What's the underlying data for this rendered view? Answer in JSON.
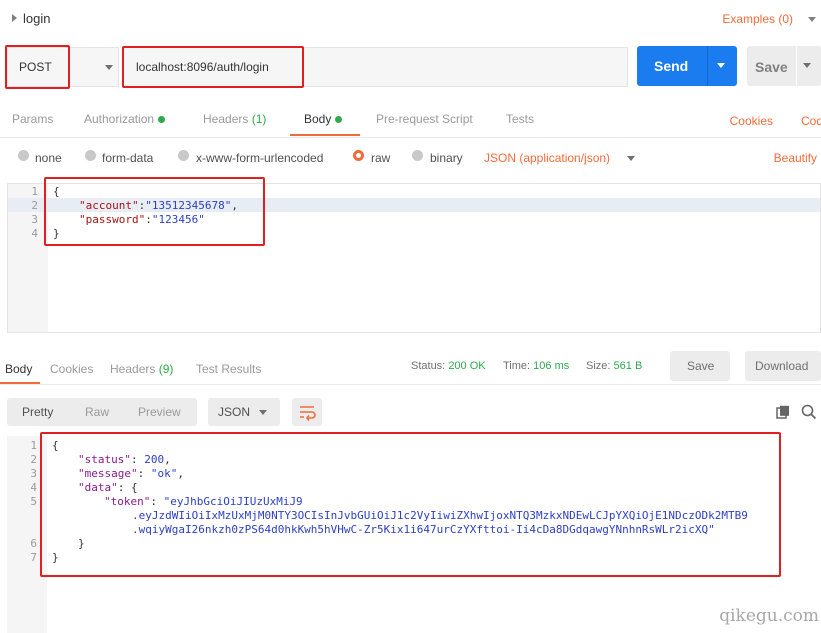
{
  "request": {
    "name": "login",
    "examples_label": "Examples (0)",
    "method": "POST",
    "url": "localhost:8096/auth/login",
    "send_label": "Send",
    "save_label": "Save"
  },
  "request_tabs": {
    "params": "Params",
    "authorization": "Authorization",
    "headers": "Headers",
    "headers_count": "(1)",
    "body": "Body",
    "pre_request": "Pre-request Script",
    "tests": "Tests",
    "cookies": "Cookies",
    "code": "Cod"
  },
  "body_types": {
    "none": "none",
    "form_data": "form-data",
    "urlencoded": "x-www-form-urlencoded",
    "raw": "raw",
    "binary": "binary",
    "selected": "raw",
    "format": "JSON (application/json)",
    "beautify": "Beautify"
  },
  "request_body": {
    "line_numbers": [
      "1",
      "2",
      "3",
      "4"
    ],
    "open": "{",
    "account_key": "\"account\"",
    "account_value": "\"13512345678\"",
    "password_key": "\"password\"",
    "password_value": "\"123456\"",
    "close": "}"
  },
  "response_tabs": {
    "body": "Body",
    "cookies": "Cookies",
    "headers": "Headers",
    "headers_count": "(9)",
    "test_results": "Test Results"
  },
  "response_meta": {
    "status_label": "Status:",
    "status_value": "200 OK",
    "time_label": "Time:",
    "time_value": "106 ms",
    "size_label": "Size:",
    "size_value": "561 B",
    "save_label": "Save",
    "download_label": "Download"
  },
  "view_toolbar": {
    "pretty": "Pretty",
    "raw": "Raw",
    "preview": "Preview",
    "format": "JSON"
  },
  "response_body": {
    "line_numbers": [
      "1",
      "2",
      "3",
      "4",
      "5",
      "",
      "",
      "6",
      "7"
    ],
    "open": "{",
    "status_key": "\"status\"",
    "status_value": "200",
    "message_key": "\"message\"",
    "message_value": "\"ok\"",
    "data_key": "\"data\"",
    "data_open": "{",
    "token_key": "\"token\"",
    "token_line1": "\"eyJhbGciOiJIUzUxMiJ9",
    "token_line2": ".eyJzdWIiOiIxMzUxMjM0NTY3OCIsInJvbGUiOiJ1c2VyIiwiZXhwIjoxNTQ3MzkxNDEwLCJpYXQiOjE1NDczODk2MTB9",
    "token_line3": ".wqiyWgaI26nkzh0zPS64d0hkKwh5hVHwC-Zr5Kix1i647urCzYXfttoi-Ii4cDa8DGdqawgYNnhnRsWLr2icXQ\"",
    "data_close": "}",
    "close": "}"
  },
  "watermark": "qikegu.com",
  "colors": {
    "accent": "#f26b3a",
    "send": "#1b7cf0",
    "success": "#2eaa4c",
    "highlight_box": "#e02020",
    "json_key": "#aa1111",
    "json_string": "#2c3fc4"
  }
}
